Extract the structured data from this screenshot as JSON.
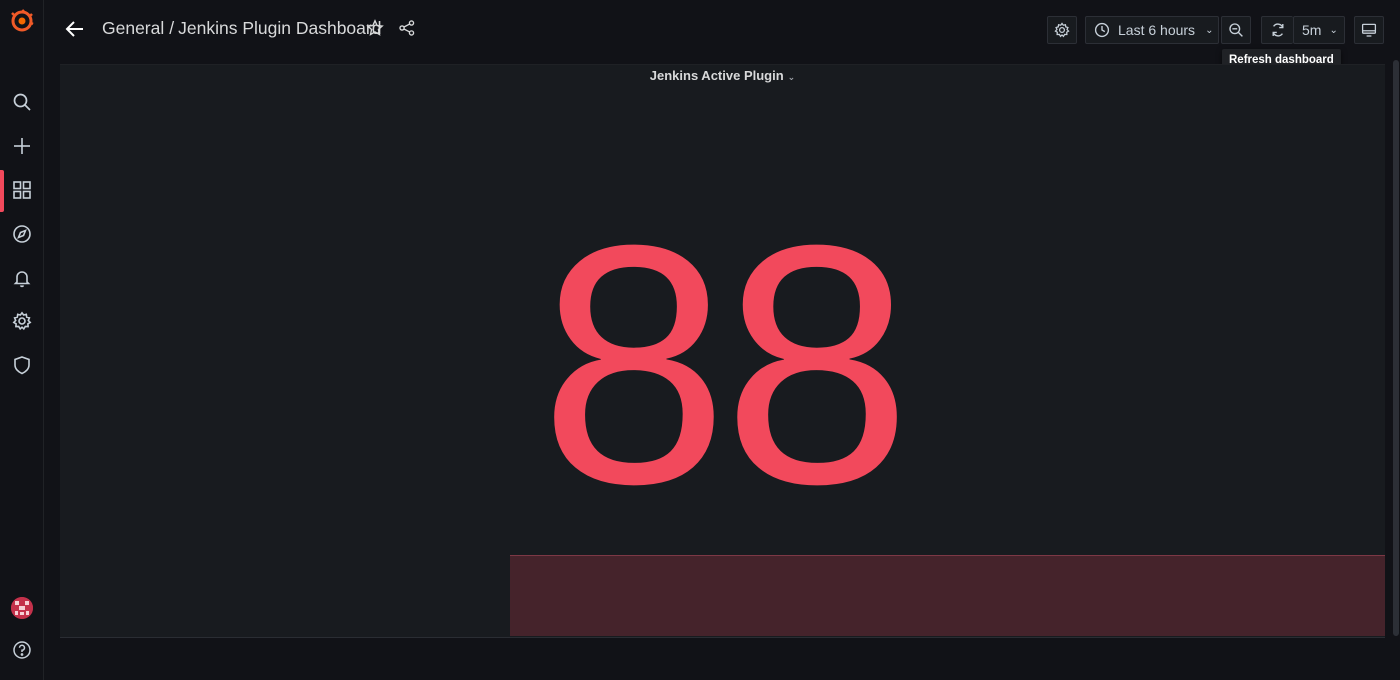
{
  "breadcrumb": {
    "folder": "General",
    "separator": "/",
    "dashboard": "Jenkins Plugin Dashboard"
  },
  "toolbar": {
    "time_range": "Last 6 hours",
    "refresh_interval": "5m",
    "refresh_tooltip": "Refresh dashboard"
  },
  "panel": {
    "title": "Jenkins Active Plugin",
    "value": "88",
    "value_color": "#f2495c",
    "sparkline_fill": "#45232b"
  },
  "sidebar": {
    "items": [
      "search-icon",
      "plus-icon",
      "dashboards-icon",
      "explore-icon",
      "alerting-icon",
      "configuration-icon",
      "server-admin-icon"
    ],
    "active": "dashboards-icon",
    "accent": "#f2495c"
  }
}
